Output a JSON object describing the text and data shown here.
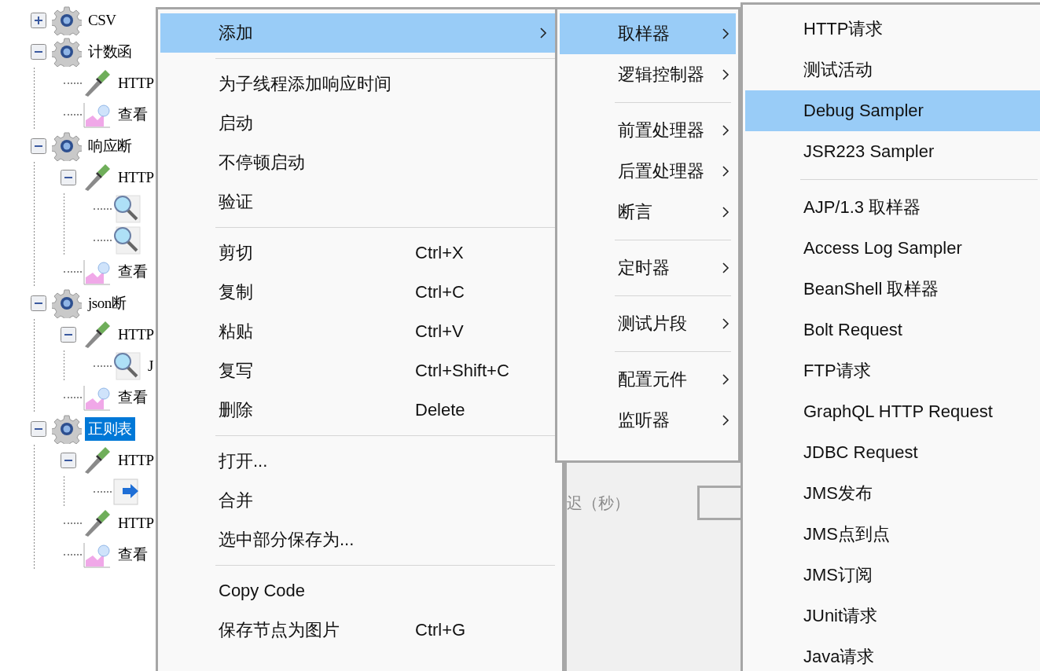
{
  "tree": [
    {
      "kind": "thread",
      "label": "CSV",
      "expanded": false,
      "selected": false
    },
    {
      "kind": "thread",
      "label": "计数函",
      "expanded": true,
      "selected": false,
      "children": [
        {
          "kind": "sampler",
          "label": "HTTP",
          "selected": false
        },
        {
          "kind": "listener",
          "label": "查看",
          "selected": false
        }
      ]
    },
    {
      "kind": "thread",
      "label": "响应断",
      "expanded": true,
      "selected": false,
      "children": [
        {
          "kind": "sampler",
          "label": "HTTP",
          "expanded": true,
          "selected": false,
          "children": [
            {
              "kind": "assertion",
              "selected": false
            },
            {
              "kind": "assertion",
              "selected": false
            }
          ]
        },
        {
          "kind": "listener",
          "label": "查看",
          "selected": false
        }
      ]
    },
    {
      "kind": "thread",
      "label": "json断",
      "expanded": true,
      "selected": false,
      "children": [
        {
          "kind": "sampler",
          "label": "HTTP",
          "expanded": true,
          "selected": false,
          "children": [
            {
              "kind": "assertion",
              "label": "J",
              "selected": false
            }
          ]
        },
        {
          "kind": "listener",
          "label": "查看",
          "selected": false
        }
      ]
    },
    {
      "kind": "thread",
      "label": "正则表",
      "expanded": true,
      "selected": true,
      "children": [
        {
          "kind": "sampler",
          "label": "HTTP",
          "expanded": true,
          "selected": false,
          "children": [
            {
              "kind": "extractor",
              "selected": false
            }
          ]
        },
        {
          "kind": "sampler",
          "label": "HTTP",
          "selected": false
        },
        {
          "kind": "listener",
          "label": "查看",
          "selected": false
        }
      ]
    }
  ],
  "panel": {
    "delay_label": "迟（秒）"
  },
  "context_menu": [
    {
      "kind": "item",
      "label": "添加",
      "submenu": true,
      "selected": true
    },
    {
      "kind": "separator"
    },
    {
      "kind": "item",
      "label": "为子线程添加响应时间",
      "submenu": false,
      "selected": false
    },
    {
      "kind": "item",
      "label": "启动",
      "submenu": false,
      "selected": false
    },
    {
      "kind": "item",
      "label": "不停顿启动",
      "submenu": false,
      "selected": false
    },
    {
      "kind": "item",
      "label": "验证",
      "submenu": false,
      "selected": false
    },
    {
      "kind": "separator"
    },
    {
      "kind": "item",
      "label": "剪切",
      "shortcut": "Ctrl+X",
      "submenu": false,
      "selected": false
    },
    {
      "kind": "item",
      "label": "复制",
      "shortcut": "Ctrl+C",
      "submenu": false,
      "selected": false
    },
    {
      "kind": "item",
      "label": "粘贴",
      "shortcut": "Ctrl+V",
      "submenu": false,
      "selected": false
    },
    {
      "kind": "item",
      "label": "复写",
      "shortcut": "Ctrl+Shift+C",
      "submenu": false,
      "selected": false
    },
    {
      "kind": "item",
      "label": "删除",
      "shortcut": "Delete",
      "submenu": false,
      "selected": false
    },
    {
      "kind": "separator"
    },
    {
      "kind": "item",
      "label": "打开...",
      "submenu": false,
      "selected": false
    },
    {
      "kind": "item",
      "label": "合并",
      "submenu": false,
      "selected": false
    },
    {
      "kind": "item",
      "label": "选中部分保存为...",
      "submenu": false,
      "selected": false
    },
    {
      "kind": "separator"
    },
    {
      "kind": "item",
      "label": "Copy Code",
      "submenu": false,
      "selected": false
    },
    {
      "kind": "item",
      "label": "保存节点为图片",
      "shortcut": "Ctrl+G",
      "submenu": false,
      "selected": false
    }
  ],
  "add_menu": [
    {
      "kind": "item",
      "label": "取样器",
      "submenu": true,
      "selected": true
    },
    {
      "kind": "item",
      "label": "逻辑控制器",
      "submenu": true,
      "selected": false
    },
    {
      "kind": "separator"
    },
    {
      "kind": "item",
      "label": "前置处理器",
      "submenu": true,
      "selected": false
    },
    {
      "kind": "item",
      "label": "后置处理器",
      "submenu": true,
      "selected": false
    },
    {
      "kind": "item",
      "label": "断言",
      "submenu": true,
      "selected": false
    },
    {
      "kind": "separator"
    },
    {
      "kind": "item",
      "label": "定时器",
      "submenu": true,
      "selected": false
    },
    {
      "kind": "separator"
    },
    {
      "kind": "item",
      "label": "测试片段",
      "submenu": true,
      "selected": false
    },
    {
      "kind": "separator"
    },
    {
      "kind": "item",
      "label": "配置元件",
      "submenu": true,
      "selected": false
    },
    {
      "kind": "item",
      "label": "监听器",
      "submenu": true,
      "selected": false
    }
  ],
  "sampler_menu": [
    {
      "kind": "item",
      "label": "HTTP请求",
      "submenu": false,
      "selected": false
    },
    {
      "kind": "item",
      "label": "测试活动",
      "submenu": false,
      "selected": false
    },
    {
      "kind": "item",
      "label": "Debug Sampler",
      "submenu": false,
      "selected": true
    },
    {
      "kind": "item",
      "label": "JSR223 Sampler",
      "submenu": false,
      "selected": false
    },
    {
      "kind": "separator"
    },
    {
      "kind": "item",
      "label": "AJP/1.3 取样器",
      "submenu": false,
      "selected": false
    },
    {
      "kind": "item",
      "label": "Access Log Sampler",
      "submenu": false,
      "selected": false
    },
    {
      "kind": "item",
      "label": "BeanShell 取样器",
      "submenu": false,
      "selected": false
    },
    {
      "kind": "item",
      "label": "Bolt Request",
      "submenu": false,
      "selected": false
    },
    {
      "kind": "item",
      "label": "FTP请求",
      "submenu": false,
      "selected": false
    },
    {
      "kind": "item",
      "label": "GraphQL HTTP Request",
      "submenu": false,
      "selected": false
    },
    {
      "kind": "item",
      "label": "JDBC Request",
      "submenu": false,
      "selected": false
    },
    {
      "kind": "item",
      "label": "JMS发布",
      "submenu": false,
      "selected": false
    },
    {
      "kind": "item",
      "label": "JMS点到点",
      "submenu": false,
      "selected": false
    },
    {
      "kind": "item",
      "label": "JMS订阅",
      "submenu": false,
      "selected": false
    },
    {
      "kind": "item",
      "label": "JUnit请求",
      "submenu": false,
      "selected": false
    },
    {
      "kind": "item",
      "label": "Java请求",
      "submenu": false,
      "selected": false
    }
  ]
}
